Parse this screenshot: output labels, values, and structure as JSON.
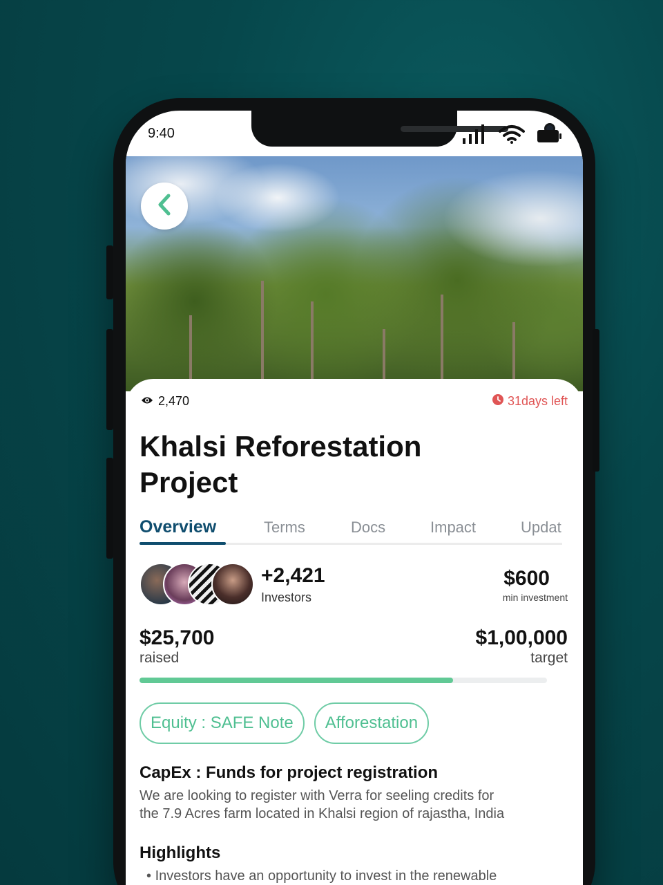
{
  "status_bar": {
    "time": "9:40",
    "icons": [
      "signal-icon",
      "wifi-icon",
      "battery-icon"
    ]
  },
  "hero": {
    "image": "trees-photo"
  },
  "stats": {
    "views": "2,470",
    "days_left": "31days left"
  },
  "project": {
    "title_line1": "Khalsi Reforestation",
    "title_line2": "Project"
  },
  "tabs": [
    {
      "label": "Overview",
      "active": true
    },
    {
      "label": "Terms"
    },
    {
      "label": "Docs"
    },
    {
      "label": "Impact"
    },
    {
      "label": "Updat"
    }
  ],
  "investors": {
    "count": "+2,421",
    "label": "Investors"
  },
  "min_investment": {
    "amount": "$600",
    "label": "min investment"
  },
  "funding": {
    "raised": "$25,700",
    "raised_label": "raised",
    "target": "$1,00,000",
    "target_label": "target",
    "progress_fraction": 0.77
  },
  "tags": [
    "Equity : SAFE Note",
    "Afforestation"
  ],
  "capex": {
    "title": "CapEx : Funds for project registration",
    "line1": "We are looking to register with Verra for seeling credits for",
    "line2": "the 7.9 Acres farm located in Khalsi region of rajastha, India"
  },
  "highlights": {
    "title": "Highlights",
    "bullet1": "Investors have an opportunity to invest in the renewable"
  },
  "colors": {
    "accent": "#0f4d6e",
    "green": "#61c995",
    "alert": "#e05555"
  }
}
